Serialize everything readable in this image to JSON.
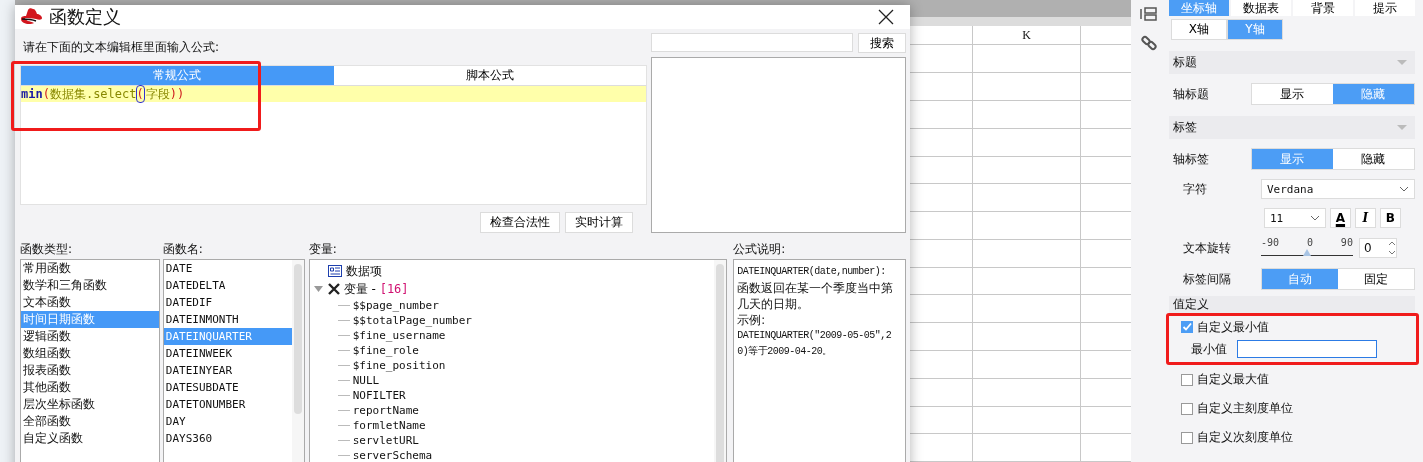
{
  "dialog": {
    "title": "函数定义",
    "prompt": "请在下面的文本编辑框里面输入公式:",
    "editor_tabs": [
      {
        "label": "常规公式",
        "selected": true
      },
      {
        "label": "脚本公式",
        "selected": false
      }
    ],
    "formula": [
      {
        "text": "min",
        "kind": "keyword"
      },
      {
        "text": "(",
        "kind": "paren"
      },
      {
        "text": "数据集.select",
        "kind": "text"
      },
      {
        "text": "(",
        "kind": "match"
      },
      {
        "text": "字段",
        "kind": "text"
      },
      {
        "text": "))",
        "kind": "paren"
      }
    ],
    "editor_buttons": [
      "检查合法性",
      "实时计算"
    ],
    "search_button": "搜索",
    "function_types": {
      "label": "函数类型:",
      "items": [
        {
          "label": "常用函数",
          "selected": false
        },
        {
          "label": "数学和三角函数",
          "selected": false
        },
        {
          "label": "文本函数",
          "selected": false
        },
        {
          "label": "时间日期函数",
          "selected": true
        },
        {
          "label": "逻辑函数",
          "selected": false
        },
        {
          "label": "数组函数",
          "selected": false
        },
        {
          "label": "报表函数",
          "selected": false
        },
        {
          "label": "其他函数",
          "selected": false
        },
        {
          "label": "层次坐标函数",
          "selected": false
        },
        {
          "label": "全部函数",
          "selected": false
        },
        {
          "label": "自定义函数",
          "selected": false
        }
      ]
    },
    "function_names": {
      "label": "函数名:",
      "items": [
        {
          "label": "DATE",
          "selected": false
        },
        {
          "label": "DATEDELTA",
          "selected": false
        },
        {
          "label": "DATEDIF",
          "selected": false
        },
        {
          "label": "DATEINMONTH",
          "selected": false
        },
        {
          "label": "DATEINQUARTER",
          "selected": true
        },
        {
          "label": "DATEINWEEK",
          "selected": false
        },
        {
          "label": "DATEINYEAR",
          "selected": false
        },
        {
          "label": "DATESUBDATE",
          "selected": false
        },
        {
          "label": "DATETONUMBER",
          "selected": false
        },
        {
          "label": "DAY",
          "selected": false
        },
        {
          "label": "DAYS360",
          "selected": false
        }
      ]
    },
    "variables": {
      "label": "变量:",
      "tree": [
        {
          "label": "数据项",
          "kind": "dataset"
        },
        {
          "label": "变量 - ",
          "count": "[16]",
          "kind": "group",
          "expanded": true,
          "children": [
            {
              "label": "$$page_number"
            },
            {
              "label": "$$totalPage_number"
            },
            {
              "label": "$fine_username"
            },
            {
              "label": "$fine_role"
            },
            {
              "label": "$fine_position"
            },
            {
              "label": "NULL"
            },
            {
              "label": "NOFILTER"
            },
            {
              "label": "reportName"
            },
            {
              "label": "formletName"
            },
            {
              "label": "servletURL"
            },
            {
              "label": "serverSchema"
            }
          ]
        }
      ]
    },
    "description": {
      "label": "公式说明:",
      "lines": [
        "DATEINQUARTER(date,number):",
        "函数返回在某一个季度当中第几天的日期。",
        "示例:",
        "DATEINQUARTER(\"2009-05-05\",20)等于2009-04-20。"
      ]
    }
  },
  "sheet": {
    "column_header": "K"
  },
  "panel": {
    "tabs": [
      {
        "label": "坐标轴",
        "selected": true
      },
      {
        "label": "数据表",
        "selected": false
      },
      {
        "label": "背景",
        "selected": false
      },
      {
        "label": "提示",
        "selected": false
      }
    ],
    "axis_tabs": [
      {
        "label": "X轴",
        "selected": false
      },
      {
        "label": "Y轴",
        "selected": true
      }
    ],
    "title_section": "标题",
    "axis_title": {
      "label": "轴标题",
      "options": [
        {
          "label": "显示",
          "selected": false
        },
        {
          "label": "隐藏",
          "selected": true
        }
      ]
    },
    "label_section": "标签",
    "axis_label": {
      "label": "轴标签",
      "options": [
        {
          "label": "显示",
          "selected": true
        },
        {
          "label": "隐藏",
          "selected": false
        }
      ]
    },
    "font": {
      "label": "字符",
      "value": "Verdana",
      "size": "11",
      "color_button": "A",
      "italic_button": "I",
      "bold_button": "B"
    },
    "rotation": {
      "label": "文本旋转",
      "ticks": [
        "-90",
        "0",
        "90"
      ],
      "level": 0.5,
      "value": "0"
    },
    "interval": {
      "label": "标签间隔",
      "options": [
        {
          "label": "自动",
          "selected": true
        },
        {
          "label": "固定",
          "selected": false
        }
      ]
    },
    "value_section": "值定义",
    "min_checkbox": {
      "label": "自定义最小值",
      "checked": true
    },
    "min_field": {
      "label": "最小值"
    },
    "checkboxes": [
      {
        "label": "自定义最大值",
        "checked": false
      },
      {
        "label": "自定义主刻度单位",
        "checked": false
      },
      {
        "label": "自定义次刻度单位",
        "checked": false
      }
    ]
  }
}
